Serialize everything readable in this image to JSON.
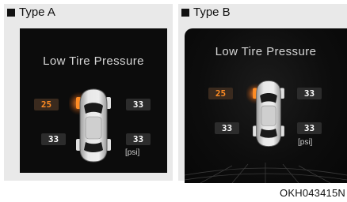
{
  "panels": [
    {
      "label": "Type A",
      "title": "Low Tire Pressure",
      "tires": {
        "front_left": "25",
        "front_right": "33",
        "rear_left": "33",
        "rear_right": "33"
      },
      "unit": "[psi]"
    },
    {
      "label": "Type B",
      "title": "Low Tire Pressure",
      "tires": {
        "front_left": "25",
        "front_right": "33",
        "rear_left": "33",
        "rear_right": "33"
      },
      "unit": "[psi]"
    }
  ],
  "caption": "OKH043415N",
  "colors": {
    "low_tire": "#ff8c24",
    "normal_tire": "#ffffff",
    "screen_bg": "#0c0c0c",
    "panel_bg": "#e9e9e9"
  },
  "icons": [
    "car-top-view-icon",
    "warning-glow-icon"
  ]
}
